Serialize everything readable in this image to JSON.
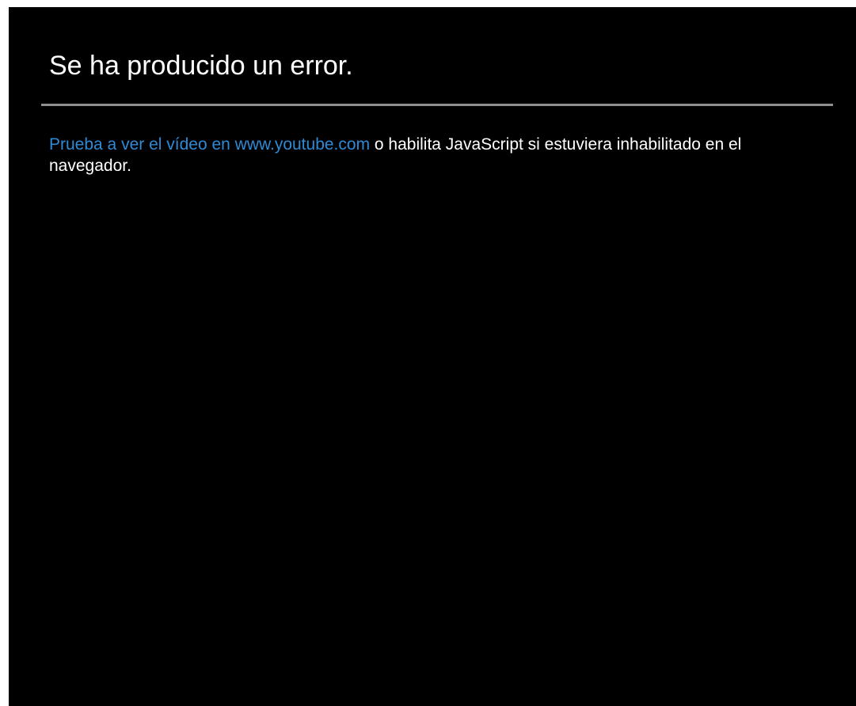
{
  "error": {
    "title": "Se ha producido un error.",
    "link_text": "Prueba a ver el vídeo en www.youtube.com",
    "message_after_link": " o habilita JavaScript si estuviera inhabilitado en el navegador."
  },
  "colors": {
    "background": "#000000",
    "text": "#ffffff",
    "link": "#2f8ad6",
    "divider": "#8f8f8f"
  }
}
